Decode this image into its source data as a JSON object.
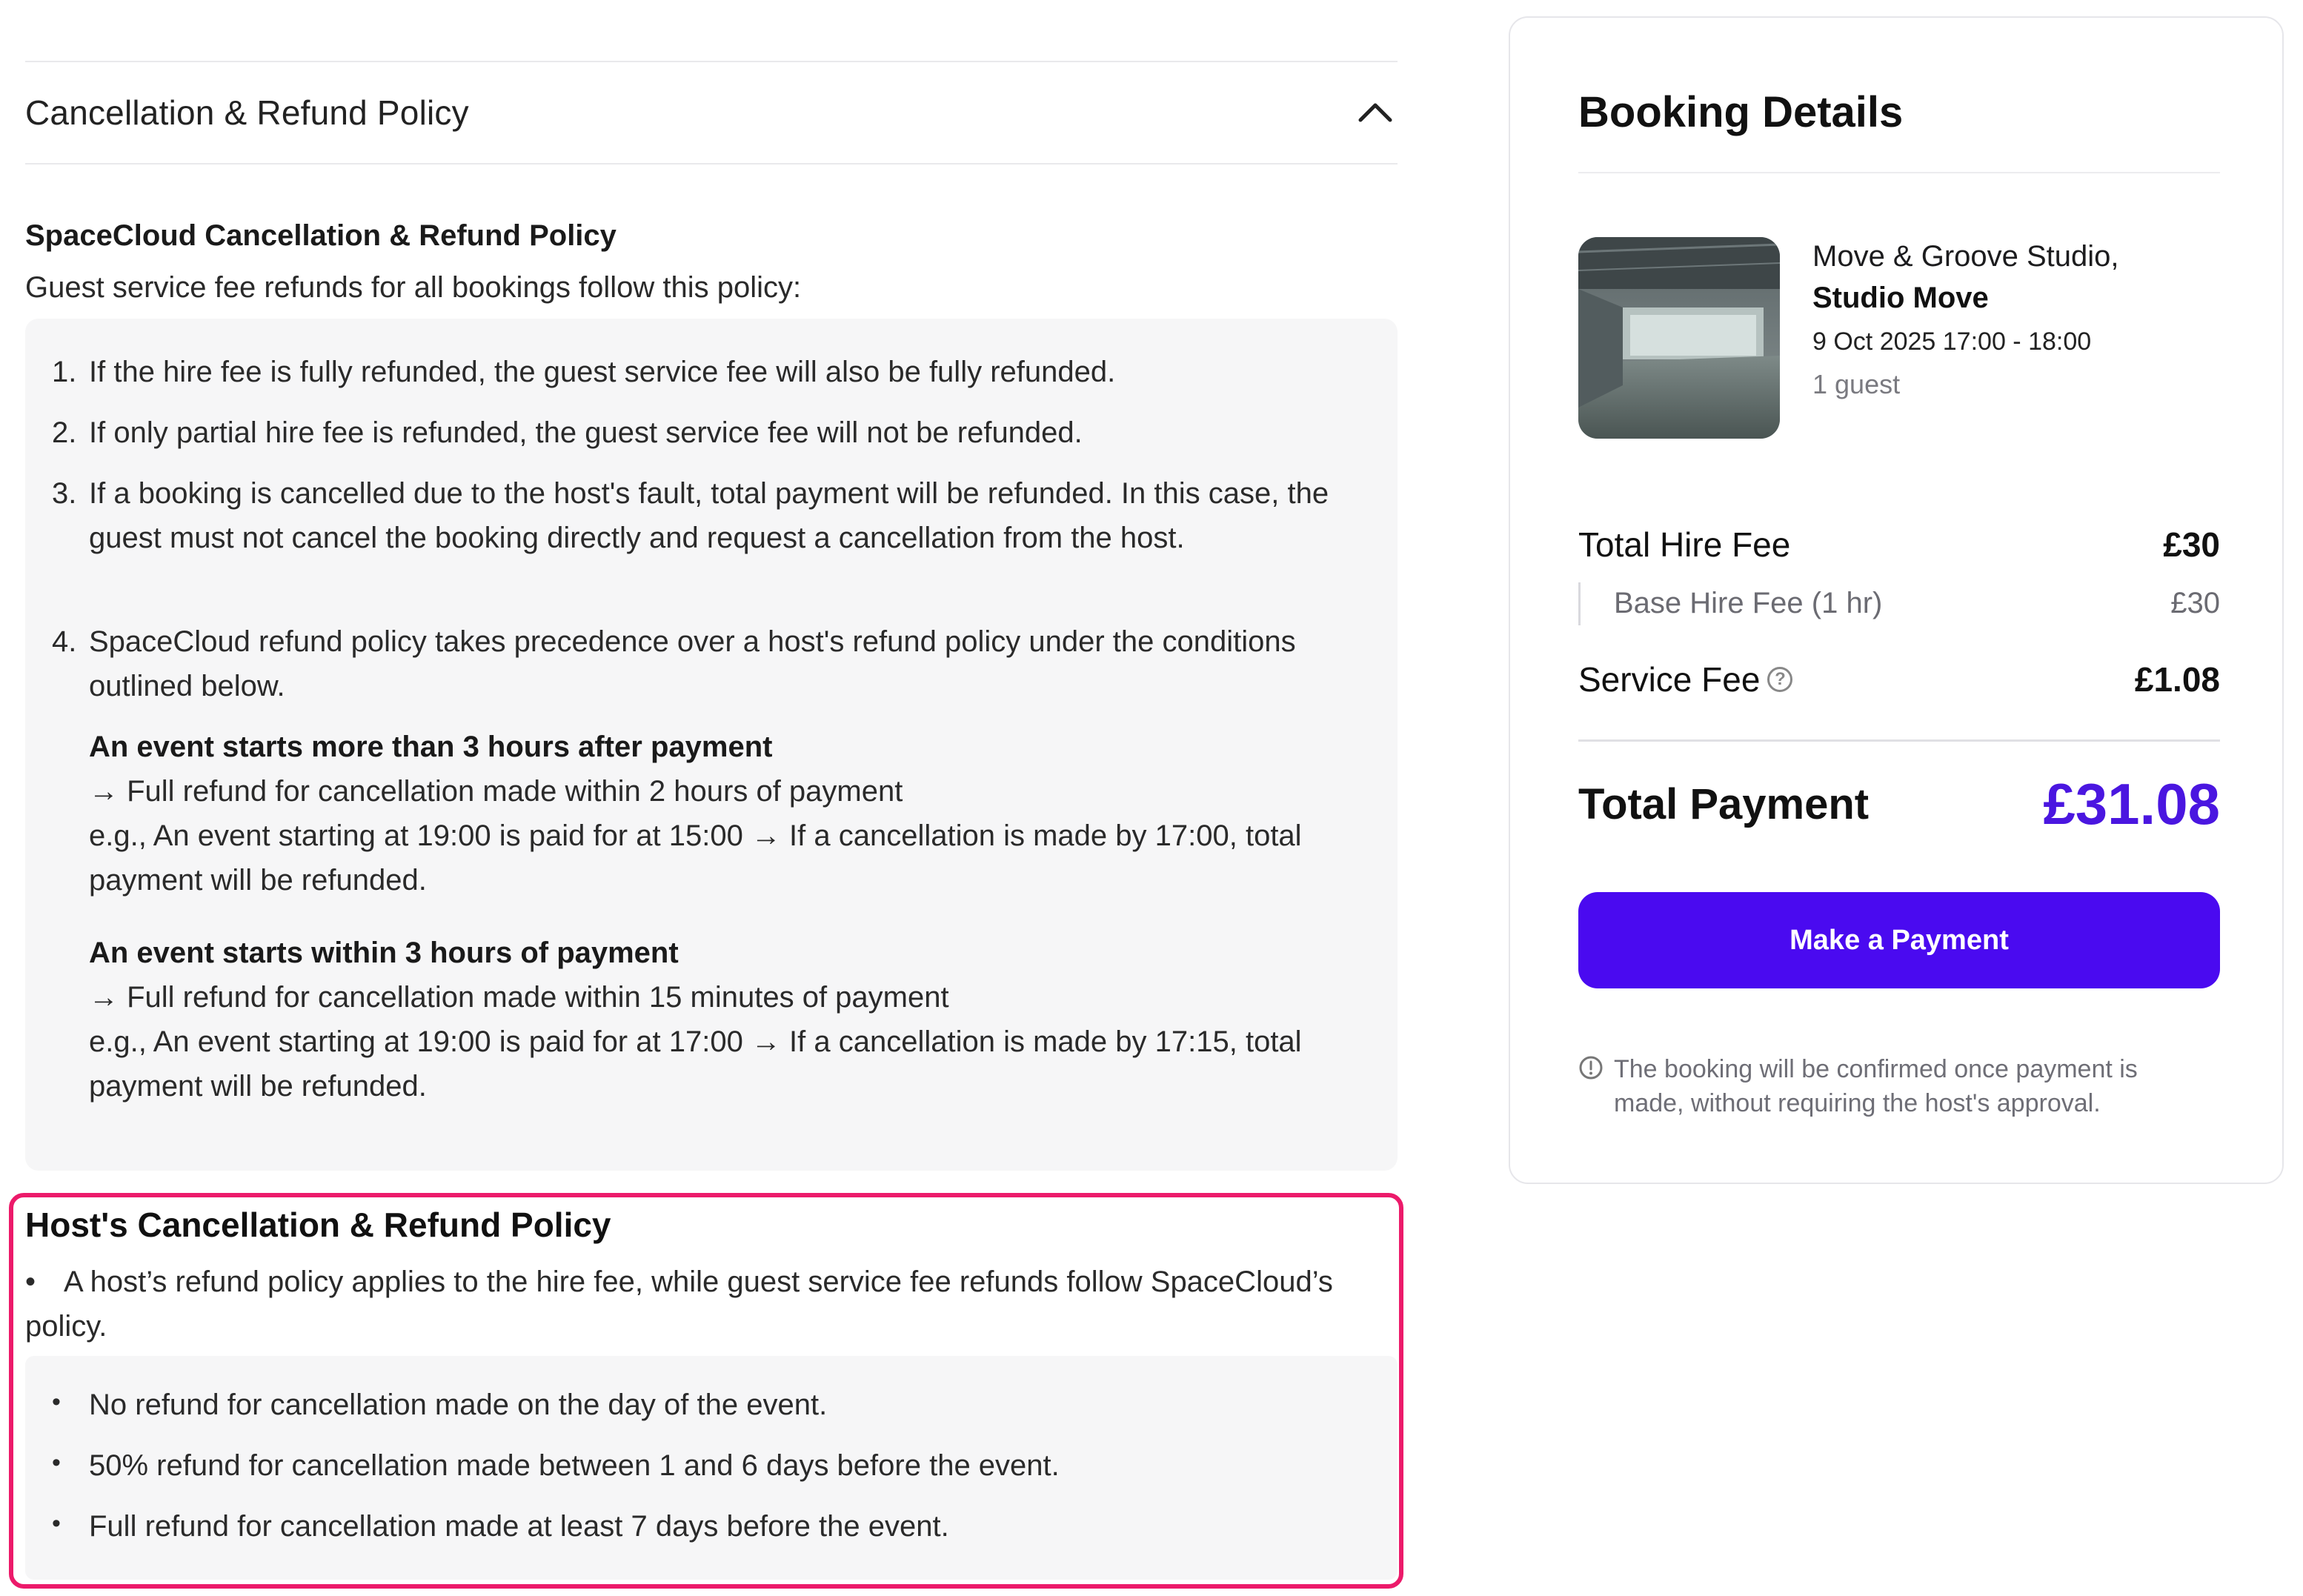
{
  "accordion": {
    "title": "Cancellation & Refund Policy",
    "icon": "chevron-up-icon"
  },
  "spacecloud_policy": {
    "title": "SpaceCloud Cancellation & Refund Policy",
    "intro": "Guest service fee refunds for all bookings follow this policy:",
    "items": [
      {
        "num": "1.",
        "text": "If the hire fee is fully refunded, the guest service fee will also be fully refunded."
      },
      {
        "num": "2.",
        "text": "If only partial hire fee is refunded, the guest service fee will not be refunded."
      },
      {
        "num": "3.",
        "text": "If a booking is cancelled due to the host's fault, total payment will be refunded. In this case, the guest must not cancel the booking directly and request a cancellation from the host."
      },
      {
        "num": "4.",
        "text": "SpaceCloud refund policy takes precedence over a host's refund policy under the conditions outlined below."
      }
    ],
    "conditions": [
      {
        "title": "An event starts more than 3 hours after payment",
        "rule": "→ Full refund for cancellation made within 2 hours of payment",
        "example": "e.g., An event starting at 19:00 is paid for at 15:00 → If a cancellation is made by 17:00, total payment will be refunded."
      },
      {
        "title": "An event starts within 3 hours of payment",
        "rule": "→ Full refund for cancellation made within 15 minutes of payment",
        "example": "e.g., An event starting at 19:00 is paid for at 17:00 → If a cancellation is made by 17:15, total payment will be refunded."
      }
    ]
  },
  "host_policy": {
    "title": "Host's Cancellation & Refund Policy",
    "summary": "A host’s refund policy applies to the hire fee, while guest service fee refunds follow SpaceCloud’s policy.",
    "items": [
      "No refund for cancellation made on the day of the event.",
      "50% refund for cancellation made between 1 and 6 days before the event.",
      "Full refund for cancellation made at least 7 days before the event."
    ],
    "highlight_color": "#ec1a6a"
  },
  "booking": {
    "title": "Booking Details",
    "venue_name": "Move & Groove Studio,",
    "space_name": "Studio Move",
    "datetime": "9 Oct 2025 17:00 - 18:00",
    "guests": "1 guest",
    "total_hire_fee_label": "Total Hire Fee",
    "total_hire_fee_value": "£30",
    "base_hire_fee_label": "Base Hire Fee (1 hr)",
    "base_hire_fee_value": "£30",
    "service_fee_label": "Service Fee",
    "service_fee_value": "£1.08",
    "total_payment_label": "Total Payment",
    "total_payment_value": "£31.08",
    "pay_button_label": "Make a Payment",
    "note": "The booking will be confirmed once payment is made, without requiring the host's approval.",
    "accent_color": "#4a0af0"
  }
}
